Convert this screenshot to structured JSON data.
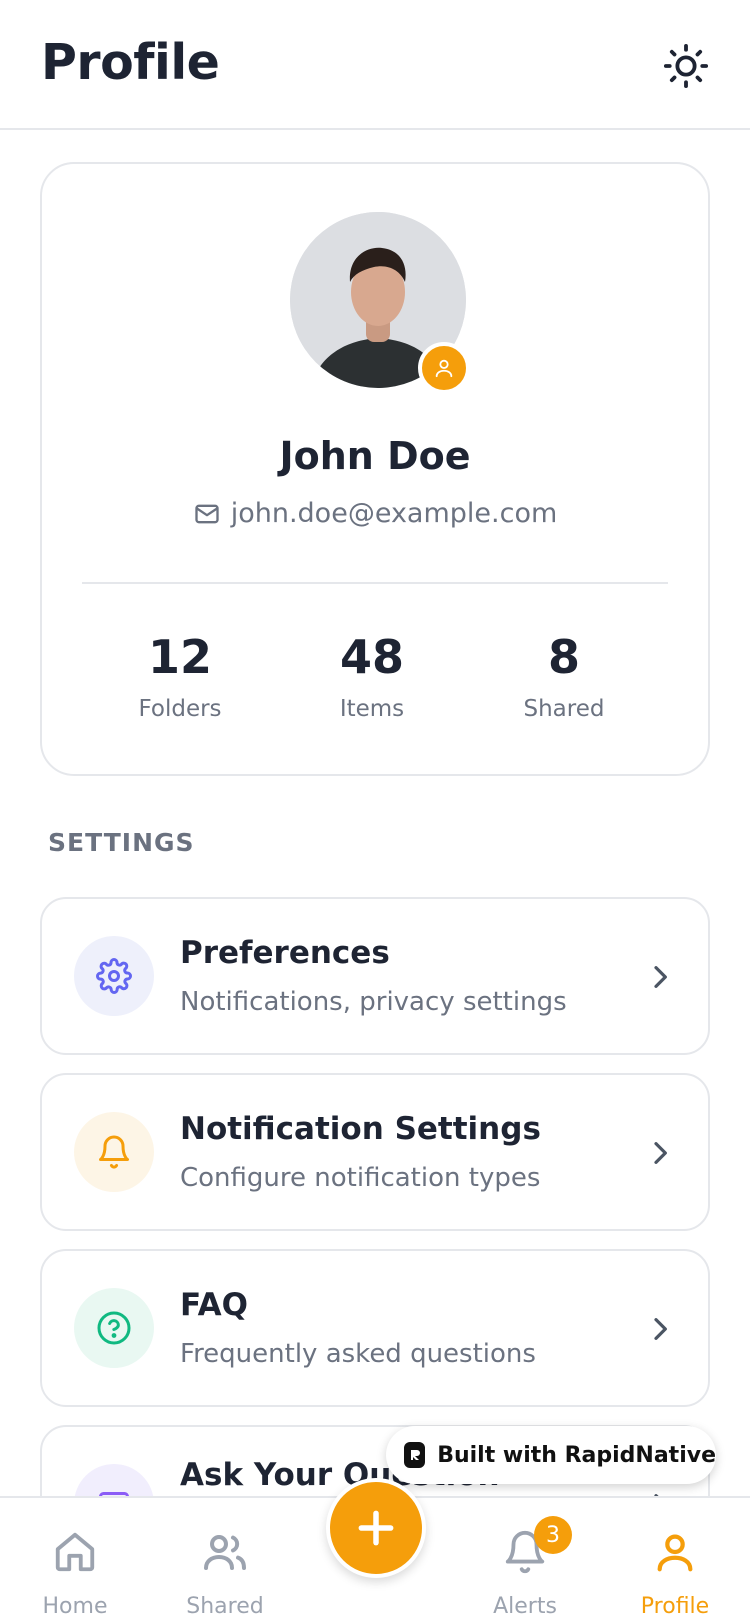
{
  "header": {
    "title": "Profile",
    "theme_icon": "sun-icon"
  },
  "profile": {
    "name": "John Doe",
    "email": "john.doe@example.com",
    "stats": [
      {
        "value": "12",
        "label": "Folders"
      },
      {
        "value": "48",
        "label": "Items"
      },
      {
        "value": "8",
        "label": "Shared"
      }
    ]
  },
  "settings": {
    "section_title": "SETTINGS",
    "items": [
      {
        "title": "Preferences",
        "subtitle": "Notifications, privacy settings",
        "icon": "gear-icon",
        "icon_color": "#6366f1",
        "icon_bg": "#eef0fb"
      },
      {
        "title": "Notification Settings",
        "subtitle": "Configure notification types",
        "icon": "bell-icon",
        "icon_color": "#f59e0b",
        "icon_bg": "#fdf5e6"
      },
      {
        "title": "FAQ",
        "subtitle": "Frequently asked questions",
        "icon": "question-circle-icon",
        "icon_color": "#10b981",
        "icon_bg": "#e9f8f2"
      },
      {
        "title": "Ask Your Question",
        "icon": "message-icon",
        "icon_color": "#8b5cf6",
        "icon_bg": "#f1eefd"
      }
    ]
  },
  "built_with": {
    "label": "Built with RapidNative"
  },
  "tab_bar": {
    "tabs": [
      {
        "label": "Home",
        "icon": "home-icon",
        "active": false
      },
      {
        "label": "Shared",
        "icon": "users-icon",
        "active": false
      },
      {
        "label": "Alerts",
        "icon": "bell-icon",
        "badge": "3",
        "active": false
      },
      {
        "label": "Profile",
        "icon": "user-icon",
        "active": true
      }
    ],
    "fab_icon": "plus-icon"
  },
  "colors": {
    "accent": "#f59e0b",
    "text": "#1e2433",
    "muted": "#6b7280",
    "border": "#e5e7eb"
  }
}
